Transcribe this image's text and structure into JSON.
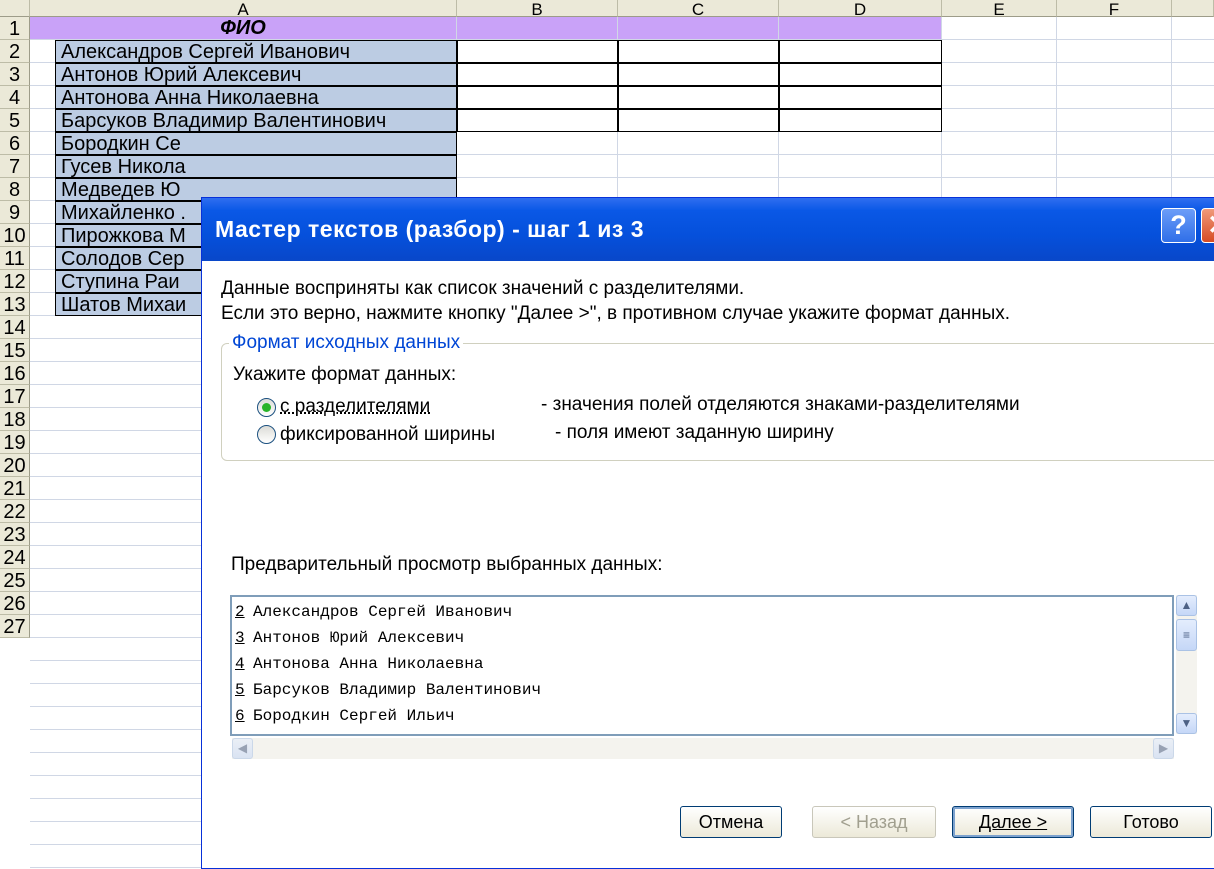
{
  "sheet": {
    "columns": [
      "A",
      "B",
      "C",
      "D",
      "E",
      "F"
    ],
    "rows": [
      "1",
      "2",
      "3",
      "4",
      "5",
      "6",
      "7",
      "8",
      "9",
      "10",
      "11",
      "12",
      "13",
      "14",
      "15",
      "16",
      "17",
      "18",
      "19",
      "20",
      "21",
      "22",
      "23",
      "24",
      "25",
      "26",
      "27"
    ],
    "header_cell": "ФИО",
    "column_a": [
      "Александров Сергей Иванович",
      "Антонов Юрий Алексевич",
      "Антонова Анна Николаевна",
      "Барсуков Владимир Валентинович",
      "Бородкин Се",
      "Гусев Никола",
      "Медведев Ю",
      "Михайленко .",
      "Пирожкова М",
      "Солодов Сер",
      "Ступина Раи",
      "Шатов Михаи"
    ],
    "header_fill": "#c9a2f8",
    "selection_fill": "#bccce3"
  },
  "dialog": {
    "title": "Мастер текстов (разбор) - шаг 1 из 3",
    "help_glyph": "?",
    "close_glyph": "✕",
    "intro_line1": "Данные восприняты как список значений с разделителями.",
    "intro_line2": "Если это верно, нажмите кнопку \"Далее >\", в противном случае укажите формат данных.",
    "group_label": "Формат исходных данных",
    "format_prompt": "Укажите формат данных:",
    "options": [
      {
        "label": "с разделителями",
        "description": "- значения полей отделяются знаками-разделителями",
        "selected": true
      },
      {
        "label": "фиксированной ширины",
        "description": "- поля имеют заданную ширину",
        "selected": false
      }
    ],
    "preview_label": "Предварительный просмотр выбранных данных:",
    "preview_lines": [
      {
        "n": "2",
        "text": "Александров Сергей Иванович"
      },
      {
        "n": "3",
        "text": "Антонов Юрий Алексевич"
      },
      {
        "n": "4",
        "text": "Антонова Анна Николаевна"
      },
      {
        "n": "5",
        "text": "Барсуков Владимир Валентинович"
      },
      {
        "n": "6",
        "text": "Бородкин Сергей Ильич"
      }
    ],
    "buttons": {
      "cancel": "Отмена",
      "back": "< Назад",
      "next": "Далее >",
      "finish": "Готово"
    },
    "icons": {
      "scroll_up": "scroll-up-arrow",
      "scroll_down": "scroll-down-arrow",
      "scroll_left": "scroll-left-arrow",
      "scroll_right": "scroll-right-arrow"
    }
  }
}
